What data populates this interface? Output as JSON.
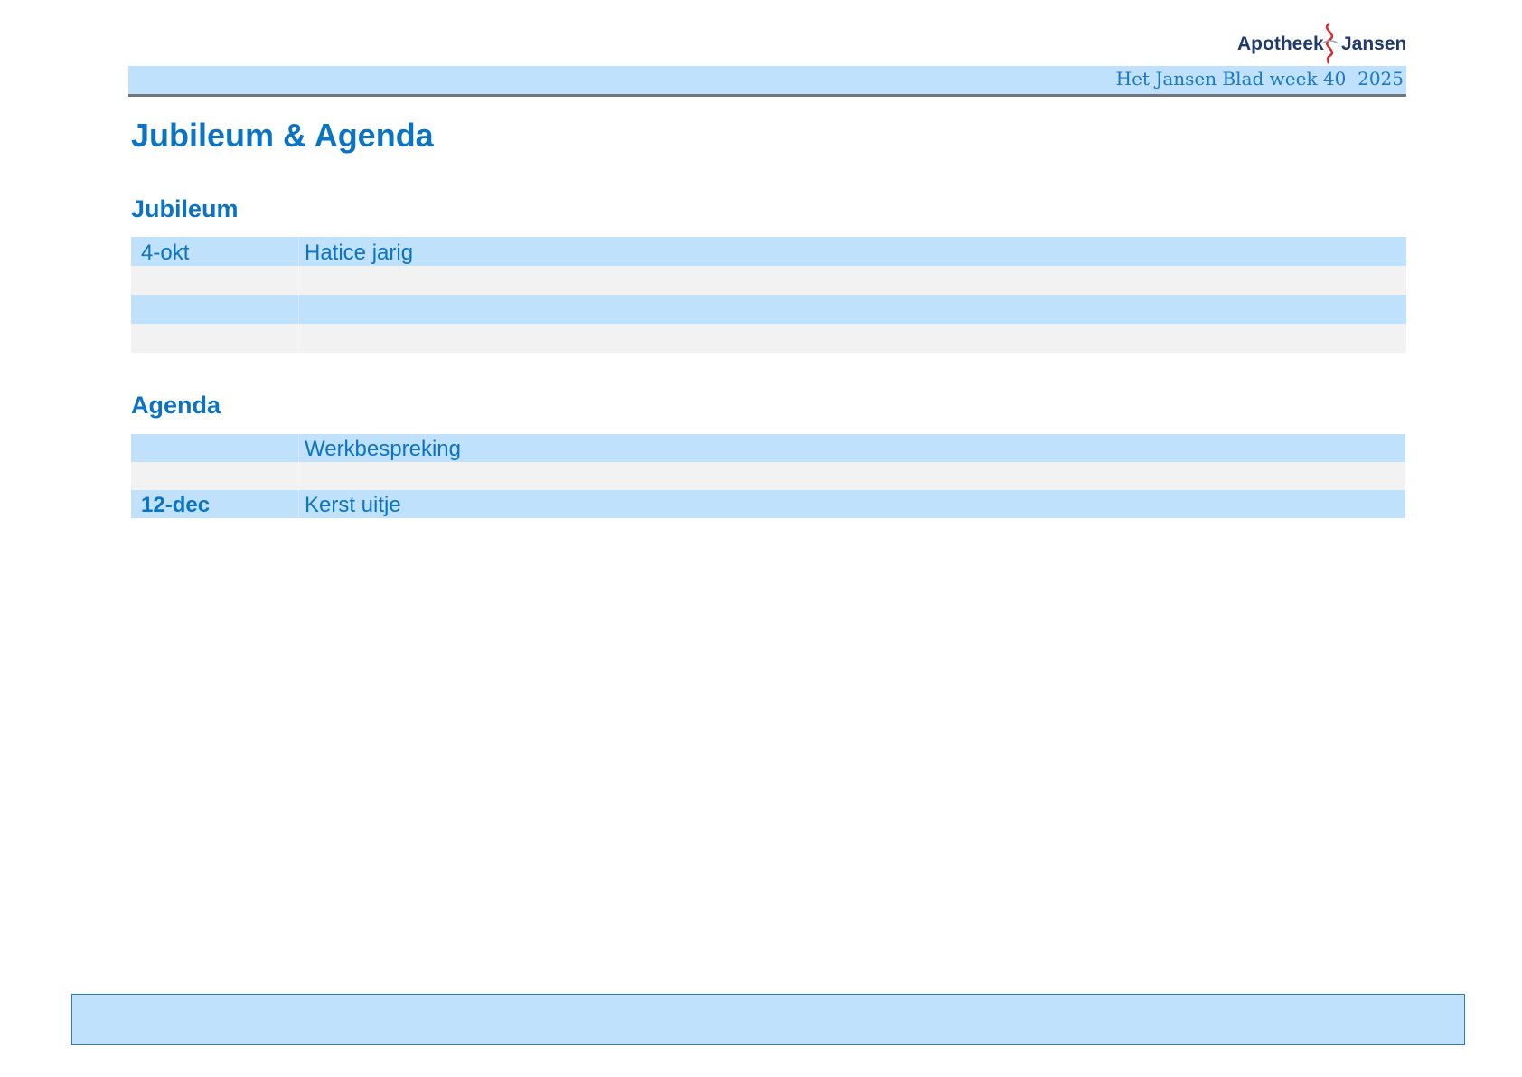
{
  "logo": {
    "brand": "Apotheek Jansen",
    "word_left": "Apotheek",
    "word_right": "Jansen",
    "icon": "caduceus-icon",
    "text_color": "#1f3a6e",
    "icon_color": "#d42a2a"
  },
  "header": {
    "text": "Het Jansen Blad week 40  2025",
    "band_color": "#bfe1fc",
    "rule_color": "#6e7580"
  },
  "page_title": "Jubileum & Agenda",
  "jubileum": {
    "title": "Jubileum",
    "rows": [
      {
        "date": "4-okt",
        "text": "Hatice jarig"
      },
      {
        "date": "",
        "text": ""
      },
      {
        "date": "",
        "text": ""
      },
      {
        "date": "",
        "text": ""
      }
    ]
  },
  "agenda": {
    "title": "Agenda",
    "rows": [
      {
        "date": "",
        "text": "Werkbespreking"
      },
      {
        "date": "",
        "text": ""
      },
      {
        "date": "12-dec",
        "text": "Kerst uitje"
      }
    ]
  },
  "colors": {
    "accent": "#0a73c4",
    "row_blue": "#bfe1fc",
    "row_grey": "#f2f2f2"
  }
}
